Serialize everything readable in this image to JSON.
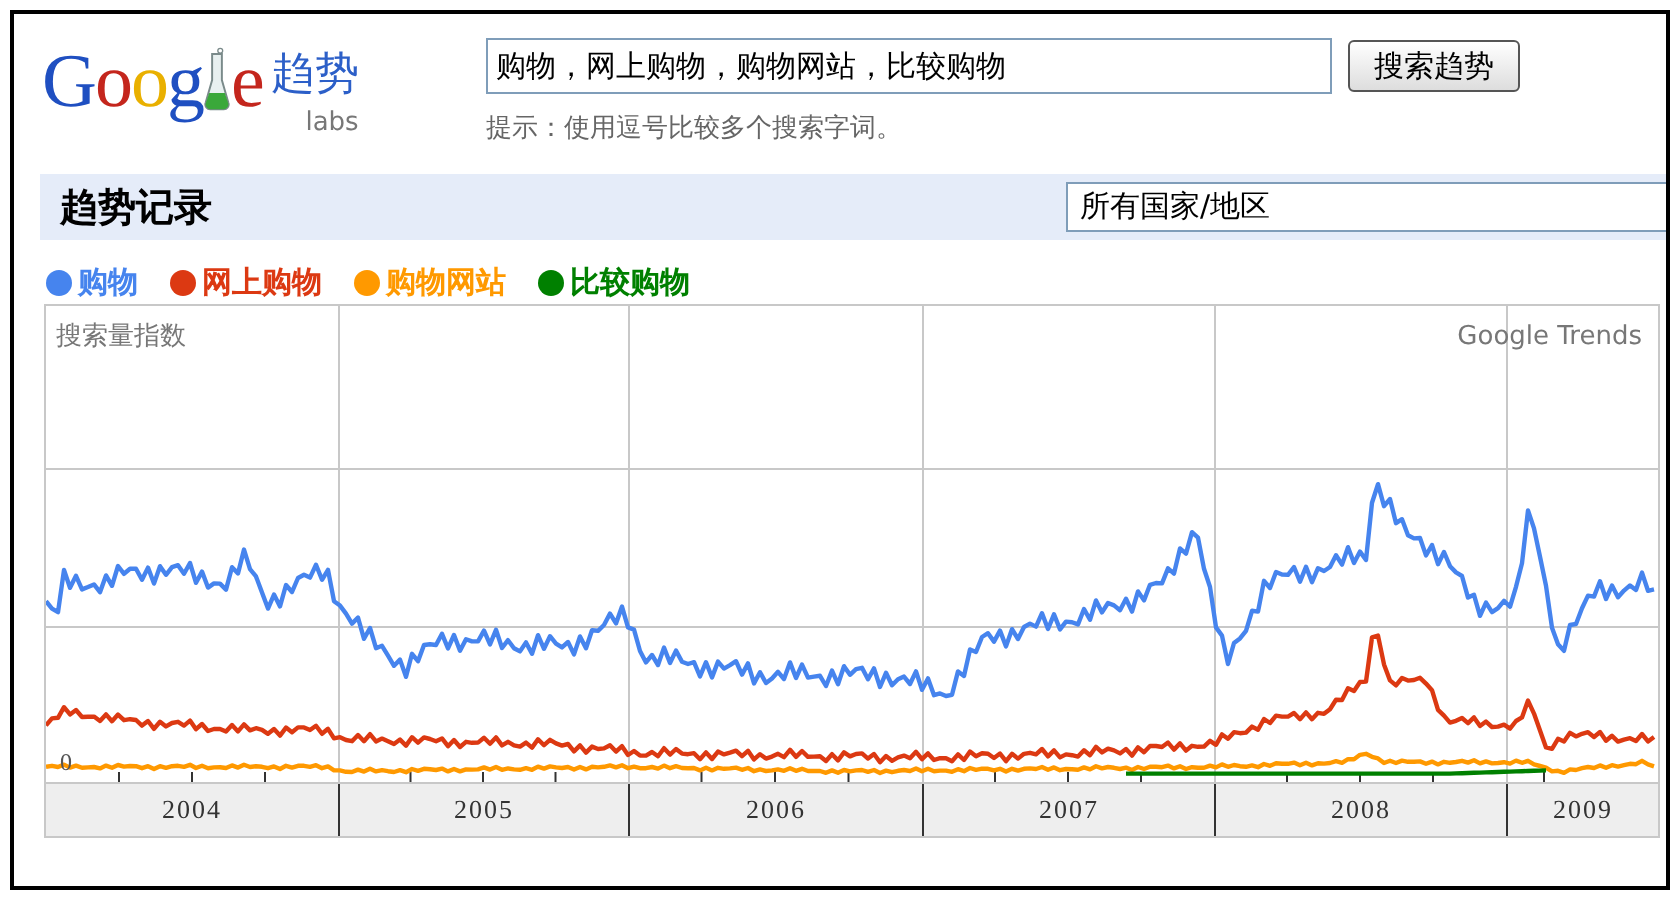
{
  "logo": {
    "letters_before": "Goog",
    "letters_after": "e",
    "product": "趋势",
    "badge": "labs"
  },
  "search": {
    "value": "购物，网上购物，购物网站，比较购物",
    "button": "搜索趋势",
    "hint": "提示：使用逗号比较多个搜索字词。"
  },
  "section": {
    "title": "趋势记录",
    "region": "所有国家/地区"
  },
  "legend": [
    {
      "label": "购物",
      "color": "#4684ee"
    },
    {
      "label": "网上购物",
      "color": "#dc3912"
    },
    {
      "label": "购物网站",
      "color": "#ff9900"
    },
    {
      "label": "比较购物",
      "color": "#008000"
    }
  ],
  "chart": {
    "ylabel": "搜索量指数",
    "watermark": "Google Trends",
    "zero_label": "0",
    "years": [
      "2004",
      "2005",
      "2006",
      "2007",
      "2008",
      "2009"
    ]
  }
}
